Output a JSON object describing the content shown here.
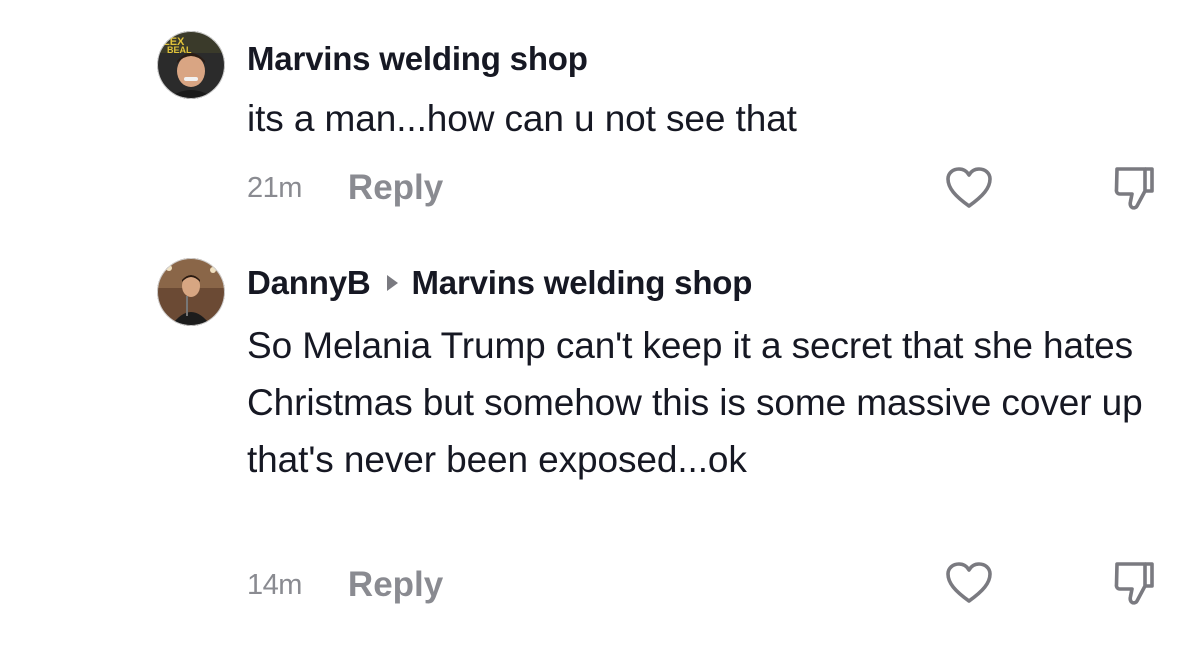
{
  "comments": [
    {
      "username": "Marvins welding shop",
      "avatar": "avatar-photo",
      "text": "its a man...how can u not see that",
      "time": "21m",
      "reply_label": "Reply",
      "like_icon": "heart-outline-icon",
      "dislike_icon": "thumbs-down-outline-icon"
    },
    {
      "username": "DannyB",
      "reply_to": "Marvins welding shop",
      "avatar": "avatar-photo",
      "text": "So Melania Trump can't keep it a secret that she hates Christmas but somehow this is some massive cover up that's never been exposed...ok",
      "time": "14m",
      "reply_label": "Reply",
      "like_icon": "heart-outline-icon",
      "dislike_icon": "thumbs-down-outline-icon"
    }
  ],
  "colors": {
    "text_primary": "#161823",
    "text_secondary": "#8a8b91",
    "icon_stroke": "#7a7a80"
  }
}
